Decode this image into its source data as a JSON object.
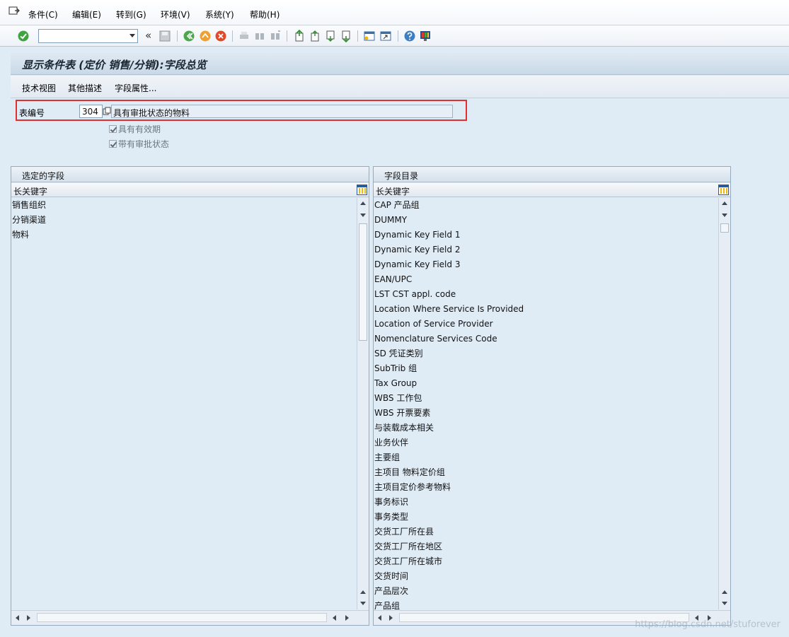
{
  "menu": {
    "items": [
      "条件(C)",
      "编辑(E)",
      "转到(G)",
      "环境(V)",
      "系统(Y)",
      "帮助(H)"
    ]
  },
  "toolbar": {
    "command_value": "",
    "back_glyph": "«"
  },
  "title": "显示条件表 (定价 销售/分销):字段总览",
  "app_toolbar": {
    "buttons": [
      "技术视图",
      "其他描述",
      "字段属性..."
    ]
  },
  "header": {
    "table_label": "表编号",
    "table_code": "304",
    "table_desc": "具有审批状态的物料",
    "check_validity": "具有有效期",
    "check_approval": "带有审批状态"
  },
  "selected_fields": {
    "title": "选定的字段",
    "column": "长关键字",
    "rows": [
      "销售组织",
      "分销渠道",
      "物料"
    ]
  },
  "field_catalog": {
    "title": "字段目录",
    "column": "长关键字",
    "rows": [
      "CAP 产品组",
      "DUMMY",
      "Dynamic Key Field 1",
      "Dynamic Key Field 2",
      "Dynamic Key Field 3",
      "EAN/UPC",
      "LST CST appl. code",
      "Location Where Service Is Provided",
      "Location of Service Provider",
      "Nomenclature Services Code",
      "SD 凭证类别",
      "SubTrib 组",
      "Tax Group",
      "WBS 工作包",
      "WBS 开票要素",
      "与装载成本相关",
      "业务伙伴",
      "主要组",
      "主项目 物料定价组",
      "主项目定价参考物料",
      "事务标识",
      "事务类型",
      "交货工厂所在县",
      "交货工厂所在地区",
      "交货工厂所在城市",
      "交货时间",
      "产品层次",
      "产品组"
    ]
  },
  "watermark": "https://blog.csdn.net/stuforever",
  "colors": {
    "highlight": "#e03030",
    "background": "#dfebf5"
  }
}
